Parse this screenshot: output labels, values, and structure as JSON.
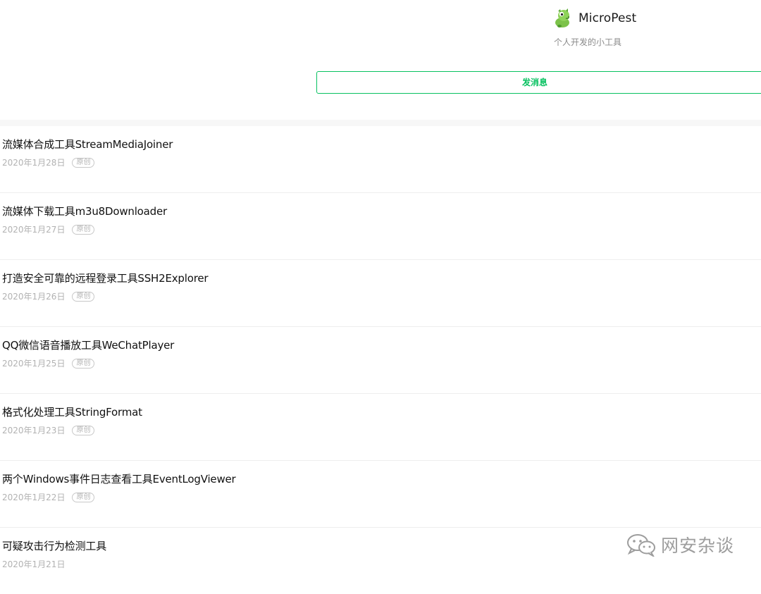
{
  "account": {
    "name": "MicroPest",
    "description": "个人开发的小工具",
    "avatar_icon": "green-dinosaur-avatar"
  },
  "message_button": {
    "label": "发消息"
  },
  "articles": [
    {
      "title": "流媒体合成工具StreamMediaJoiner",
      "date": "2020年1月28日",
      "tag": "原创"
    },
    {
      "title": "流媒体下载工具m3u8Downloader",
      "date": "2020年1月27日",
      "tag": "原创"
    },
    {
      "title": "打造安全可靠的远程登录工具SSH2Explorer",
      "date": "2020年1月26日",
      "tag": "原创"
    },
    {
      "title": "QQ微信语音播放工具WeChatPlayer",
      "date": "2020年1月25日",
      "tag": "原创"
    },
    {
      "title": "格式化处理工具StringFormat",
      "date": "2020年1月23日",
      "tag": "原创"
    },
    {
      "title": "两个Windows事件日志查看工具EventLogViewer",
      "date": "2020年1月22日",
      "tag": "原创"
    },
    {
      "title": "可疑攻击行为检测工具",
      "date": "2020年1月21日",
      "tag": ""
    }
  ],
  "watermark": {
    "text": "网安杂谈",
    "icon": "wechat-logo-icon"
  },
  "colors": {
    "accent": "#07c160",
    "meta_text": "#b2b2b2",
    "divider": "#f7f7f7"
  }
}
